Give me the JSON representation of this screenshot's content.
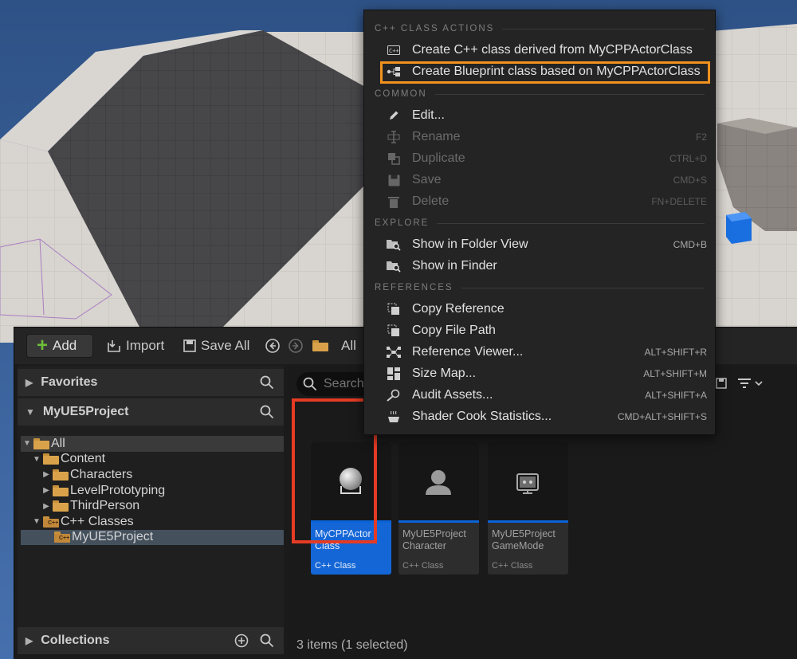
{
  "toolbar": {
    "add_label": "Add",
    "import_label": "Import",
    "save_all_label": "Save All",
    "path_label": "All"
  },
  "left_panel": {
    "favorites_label": "Favorites",
    "project_label": "MyUE5Project",
    "collections_label": "Collections",
    "tree": [
      {
        "label": "All"
      },
      {
        "label": "Content"
      },
      {
        "label": "Characters"
      },
      {
        "label": "LevelPrototyping"
      },
      {
        "label": "ThirdPerson"
      },
      {
        "label": "C++ Classes"
      },
      {
        "label": "MyUE5Project"
      }
    ]
  },
  "assets": {
    "search_placeholder": "Search",
    "items": [
      {
        "name": "MyCPPActor Class",
        "type": "C++ Class"
      },
      {
        "name": "MyUE5Project Character",
        "type": "C++ Class"
      },
      {
        "name": "MyUE5Project GameMode",
        "type": "C++ Class"
      }
    ],
    "status": "3 items (1 selected)"
  },
  "menu": {
    "sections": {
      "cpp": "C++ CLASS ACTIONS",
      "common": "COMMON",
      "explore": "EXPLORE",
      "references": "REFERENCES"
    },
    "items": [
      {
        "label": "Create C++ class derived from MyCPPActorClass",
        "shortcut": ""
      },
      {
        "label": "Create Blueprint class based on MyCPPActorClass",
        "shortcut": ""
      },
      {
        "label": "Edit...",
        "shortcut": ""
      },
      {
        "label": "Rename",
        "shortcut": "F2"
      },
      {
        "label": "Duplicate",
        "shortcut": "CTRL+D"
      },
      {
        "label": "Save",
        "shortcut": "CMD+S"
      },
      {
        "label": "Delete",
        "shortcut": "FN+DELETE"
      },
      {
        "label": "Show in Folder View",
        "shortcut": "CMD+B"
      },
      {
        "label": "Show in Finder",
        "shortcut": ""
      },
      {
        "label": "Copy Reference",
        "shortcut": ""
      },
      {
        "label": "Copy File Path",
        "shortcut": ""
      },
      {
        "label": "Reference Viewer...",
        "shortcut": "ALT+SHIFT+R"
      },
      {
        "label": "Size Map...",
        "shortcut": "ALT+SHIFT+M"
      },
      {
        "label": "Audit Assets...",
        "shortcut": "ALT+SHIFT+A"
      },
      {
        "label": "Shader Cook Statistics...",
        "shortcut": "CMD+ALT+SHIFT+S"
      }
    ]
  },
  "colors": {
    "accent_blue": "#1466d6",
    "highlight_orange": "#f2921e",
    "highlight_red": "#e53b24",
    "add_green": "#6fbf3a"
  }
}
